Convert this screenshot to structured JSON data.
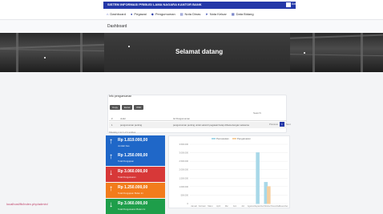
{
  "app": {
    "title": "SISTEM INFORMASI PRIBUSI LAMA NAGARA KANTOR BANK",
    "user_name": "Admin"
  },
  "nav": {
    "items": [
      {
        "label": "Dashboard",
        "icon": "home-icon"
      },
      {
        "label": "Pegawai",
        "icon": "user-icon"
      },
      {
        "label": "Pengumuman",
        "icon": "bell-icon"
      },
      {
        "label": "Nota Dinas",
        "icon": "doc-icon"
      },
      {
        "label": "Nota Keluar",
        "icon": "send-icon"
      },
      {
        "label": "Data Bidang",
        "icon": "grid-icon"
      }
    ]
  },
  "page": {
    "title": "Dashboard"
  },
  "hero": {
    "title": "Selamat datang"
  },
  "announcement": {
    "heading": "Info pengumuman",
    "buttons": [
      "Copy",
      "Excel",
      "PDF"
    ],
    "search_label": "Search:",
    "columns": [
      "#",
      "Judul",
      "Isi Pengumuman"
    ],
    "row": {
      "no": "1",
      "title": "pengumuman penting",
      "content": "pengumuman penting untuk seluruh pegawai harap dibaca dengan seksama"
    },
    "info": "Showing 1 to 1 of 1 entries",
    "pager": {
      "prev": "Previous",
      "page": "1",
      "next": "Next"
    }
  },
  "stats": [
    {
      "amount": "Rp 1.819.000,00",
      "label": "Jumlah Kas",
      "arrow": "↑",
      "color": "#1f67c8"
    },
    {
      "amount": "Rp 1.250.000,00",
      "label": "Total Pengajuan",
      "arrow": "↑",
      "color": "#1f67c8"
    },
    {
      "amount": "Rp 3.060.000,00",
      "label": "Total Pengeluaran",
      "arrow": "↓",
      "color": "#d73838"
    },
    {
      "amount": "Rp 1.250.000,00",
      "label": "Total Pengajuan Bulan Ini",
      "arrow": "↑",
      "color": "#f27c1c"
    },
    {
      "amount": "Rp 3.060.000,00",
      "label": "Total Pengeluaran Bulan Ini",
      "arrow": "↓",
      "color": "#1e9e4a"
    }
  ],
  "chart_data": {
    "type": "bar",
    "categories": [
      "Januari",
      "Februari",
      "Maret",
      "April",
      "Mei",
      "Juni",
      "Juli",
      "Agustus",
      "September",
      "Oktober",
      "November",
      "Desember"
    ],
    "series": [
      {
        "name": "Pemasukan",
        "values": [
          0,
          0,
          0,
          0,
          0,
          0,
          0,
          0,
          3000000,
          1250000,
          0,
          0
        ],
        "color": "#a8d8e8"
      },
      {
        "name": "Pengeluaran",
        "values": [
          0,
          0,
          0,
          0,
          0,
          0,
          0,
          0,
          0,
          1000000,
          0,
          0
        ],
        "color": "#f5cfa0"
      }
    ],
    "y_ticks": [
      "3.500.000",
      "3.000.000",
      "2.500.000",
      "2.000.000",
      "1.500.000",
      "1.000.000",
      "500.000",
      "0"
    ],
    "ylim": [
      0,
      3500000
    ],
    "legend": "top"
  },
  "footer": {
    "tag": "localhost/fb/index.php/admin/"
  }
}
